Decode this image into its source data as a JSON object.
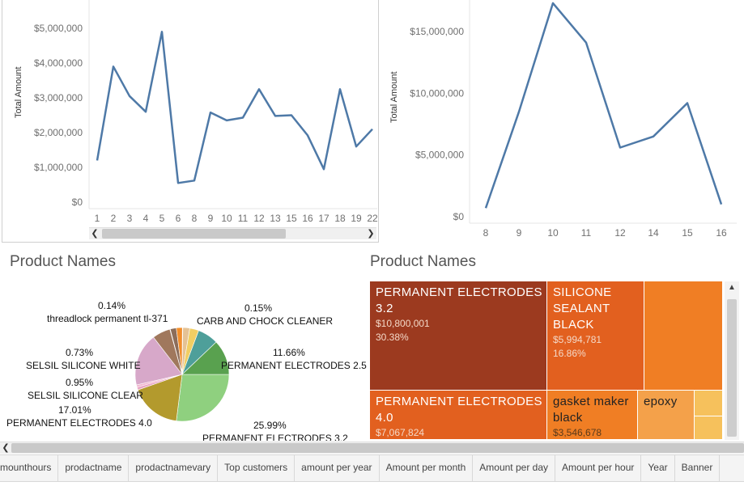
{
  "left_chart": {
    "yaxis_title": "Total Amount",
    "y_ticks": [
      "$0",
      "$1,000,000",
      "$2,000,000",
      "$3,000,000",
      "$4,000,000",
      "$5,000,000"
    ],
    "x_ticks": [
      "1",
      "2",
      "3",
      "4",
      "5",
      "6",
      "8",
      "9",
      "10",
      "11",
      "12",
      "13",
      "15",
      "16",
      "17",
      "18",
      "19",
      "22"
    ]
  },
  "right_chart": {
    "yaxis_title": "Total Amount",
    "y_ticks": [
      "$0",
      "$5,000,000",
      "$10,000,000",
      "$15,000,000"
    ],
    "x_ticks": [
      "8",
      "9",
      "10",
      "11",
      "12",
      "14",
      "15",
      "16"
    ]
  },
  "chart_data": [
    {
      "type": "line",
      "ylabel": "Total Amount",
      "x": [
        "1",
        "2",
        "3",
        "4",
        "5",
        "6",
        "8",
        "9",
        "10",
        "11",
        "12",
        "13",
        "15",
        "16",
        "17",
        "18",
        "19",
        "22"
      ],
      "values": [
        1200000,
        3900000,
        3050000,
        2600000,
        4900000,
        550000,
        620000,
        2580000,
        2350000,
        2430000,
        3250000,
        2480000,
        2500000,
        1920000,
        950000,
        3250000,
        1600000,
        2100000
      ],
      "ylim": [
        0,
        5200000
      ]
    },
    {
      "type": "line",
      "ylabel": "Total Amount",
      "x": [
        "8",
        "9",
        "10",
        "11",
        "12",
        "14",
        "15",
        "16"
      ],
      "values": [
        700000,
        8500000,
        17300000,
        14100000,
        5600000,
        6500000,
        9200000,
        1000000
      ],
      "ylim": [
        0,
        17000000
      ]
    },
    {
      "type": "pie",
      "title": "Product Names",
      "slices": [
        {
          "label": "PERMANENT ELECTRODES 3.2",
          "percent": "25.99%",
          "value": 25.99,
          "color": "#8fd07f"
        },
        {
          "label": "PERMANENT ELECTRODES 4.0",
          "percent": "17.01%",
          "value": 17.01,
          "color": "#b39a2d"
        },
        {
          "label": "SELSIL SILICONE CLEAR",
          "percent": "0.95%",
          "value": 0.95,
          "color": "#e8a6c4"
        },
        {
          "label": "SELSIL SILICONE WHITE",
          "percent": "0.73%",
          "value": 0.73,
          "color": "#f2b6cf"
        },
        {
          "label": "",
          "percent": "",
          "value": 17.5,
          "color": "#d7a8c9"
        },
        {
          "label": "",
          "percent": "",
          "value": 6.0,
          "color": "#a0785d"
        },
        {
          "label": "threadlock permanent tl-371",
          "percent": "0.14%",
          "value": 0.14,
          "color": "#f5c07a"
        },
        {
          "label": "",
          "percent": "",
          "value": 2.0,
          "color": "#8c6d5a"
        },
        {
          "label": "",
          "percent": "",
          "value": 2.0,
          "color": "#f28e2b"
        },
        {
          "label": "CARB AND CHOCK CLEANER",
          "percent": "0.15%",
          "value": 0.15,
          "color": "#ffbe7d"
        },
        {
          "label": "",
          "percent": "",
          "value": 2.3,
          "color": "#e5c294"
        },
        {
          "label": "",
          "percent": "",
          "value": 3.0,
          "color": "#f1ce63"
        },
        {
          "label": "",
          "percent": "",
          "value": 6.9,
          "color": "#4e9f9a"
        },
        {
          "label": "PERMANENT ELECTRODES 2.5",
          "percent": "11.66%",
          "value": 11.66,
          "color": "#59a14f"
        }
      ]
    },
    {
      "type": "treemap",
      "title": "Product Names",
      "items": [
        {
          "label": "PERMANENT ELECTRODES 3.2",
          "amount": "$10,800,001",
          "percent": "30.38%"
        },
        {
          "label": "SILICONE SEALANT BLACK",
          "amount": "$5,994,781",
          "percent": "16.86%"
        },
        {
          "label": "PERMANENT ELECTRODES 4.0",
          "amount": "$7,067,824",
          "percent": ""
        },
        {
          "label": "gasket maker black",
          "amount": "$3,546,678",
          "percent": ""
        },
        {
          "label": "epoxy",
          "amount": "",
          "percent": ""
        }
      ]
    }
  ],
  "pie_title": "Product Names",
  "pie_labels": {
    "l1_pct": "0.14%",
    "l1_name": "threadlock permanent tl-371",
    "l2_pct": "0.15%",
    "l2_name": "CARB AND CHOCK CLEANER",
    "l3_pct": "0.73%",
    "l3_name": "SELSIL SILICONE WHITE",
    "l4_pct": "11.66%",
    "l4_name": "PERMANENT ELECTRODES 2.5",
    "l5_pct": "0.95%",
    "l5_name": "SELSIL SILICONE CLEAR",
    "l6_pct": "17.01%",
    "l6_name": "PERMANENT ELECTRODES 4.0",
    "l7_pct": "25.99%",
    "l7_name": "PERMANENT ELECTRODES 3.2"
  },
  "treemap_title": "Product Names",
  "treemap": {
    "t1_name": "PERMANENT ELECTRODES 3.2",
    "t1_amount": "$10,800,001",
    "t1_pct": "30.38%",
    "t2_name": "SILICONE SEALANT BLACK",
    "t2_amount": "$5,994,781",
    "t2_pct": "16.86%",
    "t3_name": "PERMANENT ELECTRODES 4.0",
    "t3_amount": "$7,067,824",
    "t4_name": "gasket maker black",
    "t4_amount": "$3,546,678",
    "t5_name": "epoxy"
  },
  "tabs": [
    "mounthours",
    "prodactname",
    "prodactnamevary",
    "Top customers",
    "amount per year",
    "Amount per month",
    "Amount per day",
    "Amount per hour",
    "Year",
    "Banner"
  ],
  "colors": {
    "line": "#4e79a7",
    "treemap_dark": "#9c3a1f",
    "treemap_mid": "#e2601f",
    "treemap_orange": "#f07e24",
    "treemap_light": "#f4a14a",
    "treemap_pale": "#f6c15c"
  }
}
